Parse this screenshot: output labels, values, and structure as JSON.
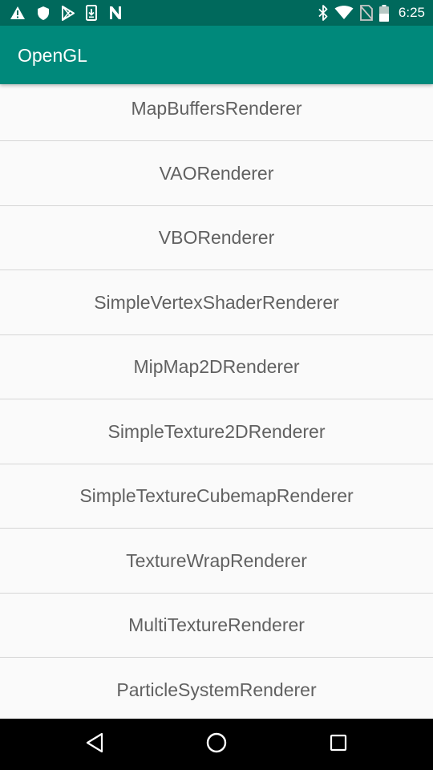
{
  "status_bar": {
    "time": "6:25",
    "left_icons": [
      "warning-icon",
      "shield-icon",
      "play-store-icon",
      "download-icon",
      "n-icon"
    ],
    "right_icons": [
      "bluetooth-icon",
      "wifi-icon",
      "no-sim-icon",
      "battery-icon"
    ]
  },
  "app_bar": {
    "title": "OpenGL",
    "color": "#00897b"
  },
  "list": {
    "items": [
      {
        "label": "MapBuffersRenderer"
      },
      {
        "label": "VAORenderer"
      },
      {
        "label": "VBORenderer"
      },
      {
        "label": "SimpleVertexShaderRenderer"
      },
      {
        "label": "MipMap2DRenderer"
      },
      {
        "label": "SimpleTexture2DRenderer"
      },
      {
        "label": "SimpleTextureCubemapRenderer"
      },
      {
        "label": "TextureWrapRenderer"
      },
      {
        "label": "MultiTextureRenderer"
      },
      {
        "label": "ParticleSystemRenderer"
      }
    ]
  },
  "nav_bar": {
    "buttons": [
      "back-icon",
      "home-icon",
      "recents-icon"
    ]
  }
}
